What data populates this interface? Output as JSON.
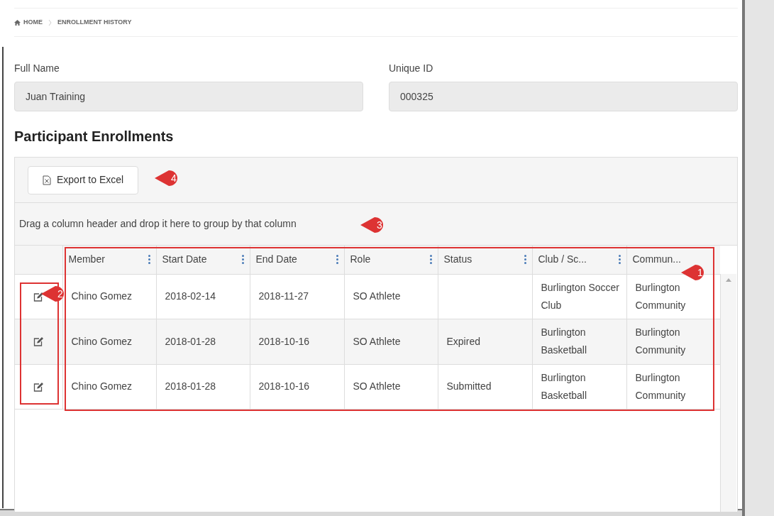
{
  "breadcrumb": [
    {
      "label": "HOME"
    },
    {
      "label": "ENROLLMENT HISTORY"
    }
  ],
  "fields": [
    {
      "label": "Full Name",
      "value": "Juan Training"
    },
    {
      "label": "Unique ID",
      "value": "000325"
    }
  ],
  "section_title": "Participant Enrollments",
  "toolbar": {
    "export_button": "Export to Excel"
  },
  "group_hint": "Drag a column header and drop it here to group by that column",
  "table": {
    "columns": [
      "Member",
      "Start Date",
      "End Date",
      "Role",
      "Status",
      "Club / Sc...",
      "Commun..."
    ],
    "rows": [
      [
        "Chino Gomez",
        "2018-02-14",
        "2018-11-27",
        "SO Athlete",
        "",
        "Burlington Soccer Club",
        "Burlington Community"
      ],
      [
        "Chino Gomez",
        "2018-01-28",
        "2018-10-16",
        "SO Athlete",
        "Expired",
        "Burlington Basketball",
        "Burlington Community"
      ],
      [
        "Chino Gomez",
        "2018-01-28",
        "2018-10-16",
        "SO Athlete",
        "Submitted",
        "Burlington Basketball",
        "Burlington Community"
      ]
    ]
  },
  "callouts": [
    {
      "number": "1"
    },
    {
      "number": "2"
    },
    {
      "number": "3"
    },
    {
      "number": "4"
    }
  ]
}
